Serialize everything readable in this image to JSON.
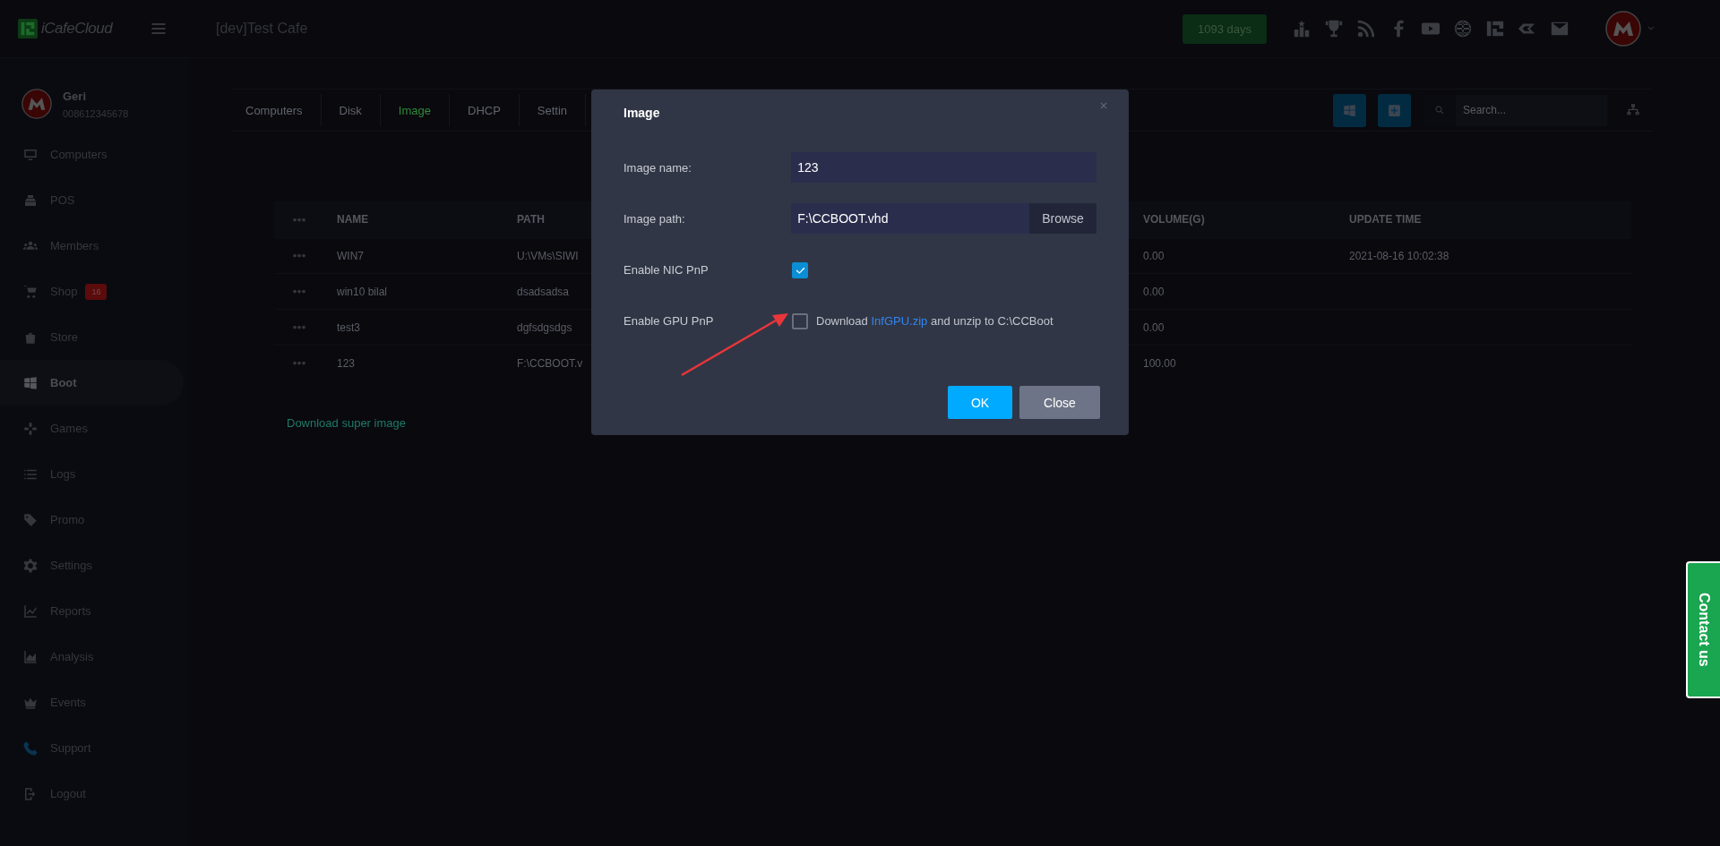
{
  "header": {
    "logo": "iCafeCloud",
    "title": "[dev]Test Cafe",
    "days": "1093 days"
  },
  "user": {
    "name": "Geri",
    "phone": "008612345678"
  },
  "sidebar": {
    "items": [
      {
        "label": "Computers",
        "selected": false
      },
      {
        "label": "POS",
        "selected": false
      },
      {
        "label": "Members",
        "selected": false
      },
      {
        "label": "Shop",
        "selected": false,
        "badge": "16"
      },
      {
        "label": "Store",
        "selected": false
      },
      {
        "label": "Boot",
        "selected": true
      },
      {
        "label": "Games",
        "selected": false
      },
      {
        "label": "Logs",
        "selected": false
      },
      {
        "label": "Promo",
        "selected": false
      },
      {
        "label": "Settings",
        "selected": false
      },
      {
        "label": "Reports",
        "selected": false
      },
      {
        "label": "Analysis",
        "selected": false
      },
      {
        "label": "Events",
        "selected": false
      },
      {
        "label": "Support",
        "selected": false
      },
      {
        "label": "Logout",
        "selected": false
      }
    ]
  },
  "tabs": [
    {
      "label": "Computers",
      "selected": false
    },
    {
      "label": "Disk",
      "selected": false
    },
    {
      "label": "Image",
      "selected": true
    },
    {
      "label": "DHCP",
      "selected": false
    },
    {
      "label": "Settin",
      "selected": false
    }
  ],
  "search": {
    "placeholder": "Search..."
  },
  "table": {
    "columns": [
      "NAME",
      "PATH",
      "VOLUME(G)",
      "UPDATE TIME"
    ],
    "rows": [
      {
        "name": "WIN7",
        "path": "U:\\VMs\\SIWI",
        "volume": "0.00",
        "update_time": "2021-08-16 10:02:38"
      },
      {
        "name": "win10 bilal",
        "path": "dsadsadsa",
        "volume": "0.00",
        "update_time": ""
      },
      {
        "name": "test3",
        "path": "dgfsdgsdgs",
        "volume": "0.00",
        "update_time": ""
      },
      {
        "name": "123",
        "path": "F:\\CCBOOT.v",
        "volume": "100.00",
        "update_time": ""
      }
    ]
  },
  "download_link": "Download super image",
  "dialog": {
    "title": "Image",
    "fields": [
      {
        "kind": "text",
        "label": "Image name:",
        "value": "123"
      },
      {
        "kind": "file",
        "label": "Image path:",
        "value": "F:\\CCBOOT.vhd",
        "button": "Browse"
      },
      {
        "kind": "checkbox",
        "label": "Enable NIC PnP",
        "checked": true
      },
      {
        "kind": "checkbox",
        "label": "Enable GPU PnP",
        "checked": false,
        "note_before": "Download",
        "link": "InfGPU.zip",
        "note_after": "and unzip to C:\\CCBoot"
      }
    ],
    "buttons": [
      {
        "kind": "primary",
        "label": "OK"
      },
      {
        "kind": "secondary",
        "label": "Close"
      }
    ]
  },
  "contact": "Contact us"
}
